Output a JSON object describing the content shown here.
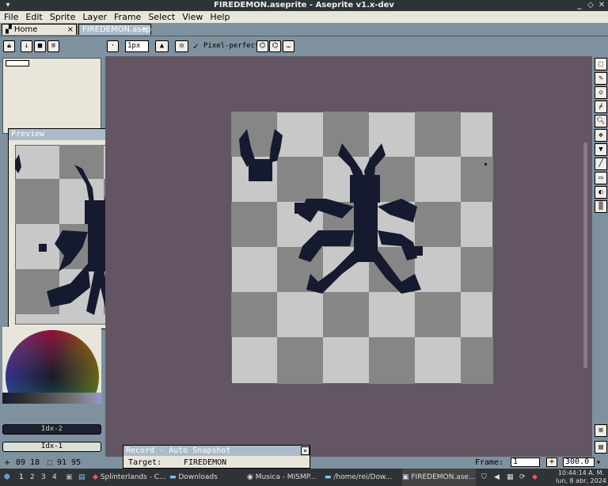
{
  "window": {
    "title": "FIREDEMON.aseprite - Aseprite v1.x-dev"
  },
  "menu": [
    "File",
    "Edit",
    "Sprite",
    "Layer",
    "Frame",
    "Select",
    "View",
    "Help"
  ],
  "tabs": [
    {
      "label": "Home",
      "close": "×"
    },
    {
      "label": "FIREDEMON.asep",
      "close": "×"
    }
  ],
  "toolbar": {
    "brush_size": "1px",
    "pixel_perfect_label": "Pixel-perfect",
    "pixel_perfect_checked": "✓"
  },
  "preview": {
    "title": "Preview"
  },
  "color": {
    "fg_index": "Idx-2",
    "bg_index": "Idx-1"
  },
  "status": {
    "cursor_pos": "89 18",
    "sprite_size": "91 95",
    "frame_label": "Frame:",
    "frame_value": "1",
    "zoom": "300.0"
  },
  "record": {
    "title": "Record - Auto Snapshot",
    "target_label": "Target:",
    "target_value": "FIREDEMON",
    "close": "×"
  },
  "taskbar": {
    "workspaces": [
      "1",
      "2",
      "3",
      "4"
    ],
    "apps": [
      {
        "label": "Splinterlands - C..."
      },
      {
        "label": "Downloads"
      },
      {
        "label": "Musica - MISMP..."
      },
      {
        "label": "/home/rei/Dow..."
      },
      {
        "label": "FIREDEMON.ase..."
      }
    ],
    "clock_time": "10:44:14 A. M.",
    "clock_date": "lun, 8 abr, 2024"
  },
  "colors": {
    "accent": "#aabccb",
    "canvas_bg": "#645562",
    "ui_bg": "#7d929e",
    "sprite_ink": "#161a2e"
  }
}
